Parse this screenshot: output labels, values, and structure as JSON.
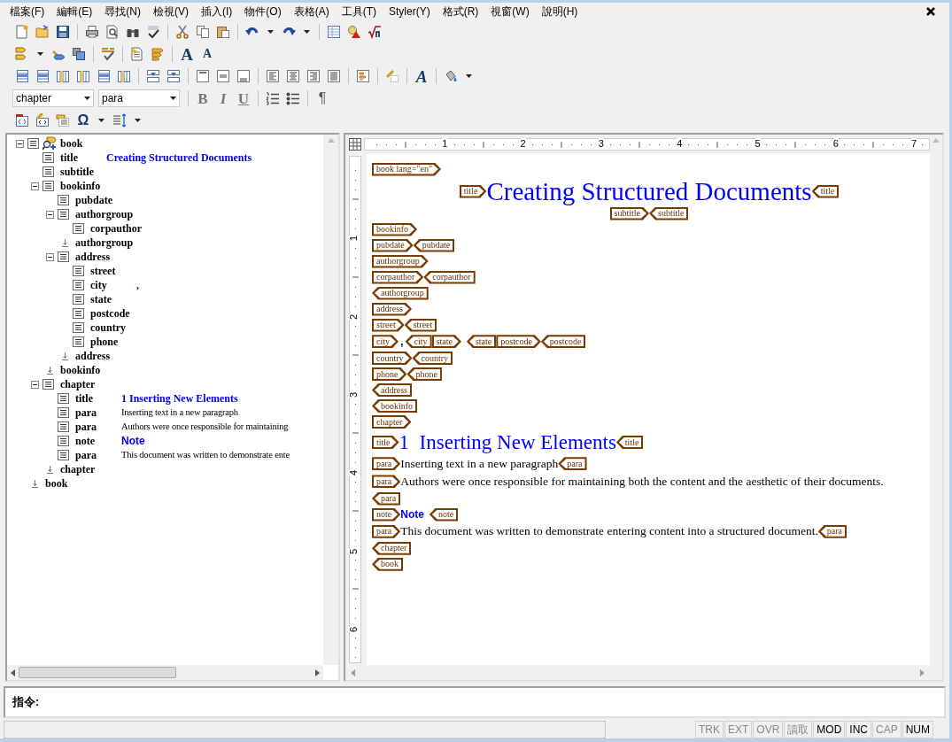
{
  "menu": [
    "檔案(F)",
    "編輯(E)",
    "尋找(N)",
    "檢視(V)",
    "插入(I)",
    "物件(O)",
    "表格(A)",
    "工具(T)",
    "Styler(Y)",
    "格式(R)",
    "視窗(W)",
    "說明(H)"
  ],
  "toolbar": {
    "glyphs": [
      "A",
      "A",
      "A",
      "B",
      "I",
      "U",
      "¶",
      "Ω"
    ],
    "element_combo": "chapter",
    "style_combo": "para"
  },
  "tree": [
    {
      "kind": "root",
      "tag": "book",
      "expanded": true,
      "children": [
        {
          "kind": "element",
          "tag": "title",
          "content": {
            "kind": "heading",
            "text": "Creating Structured Documents"
          }
        },
        {
          "kind": "element",
          "tag": "subtitle"
        },
        {
          "kind": "element",
          "tag": "bookinfo",
          "expanded": true,
          "children": [
            {
              "kind": "element",
              "tag": "pubdate"
            },
            {
              "kind": "element",
              "tag": "authorgroup",
              "expanded": true,
              "children": [
                {
                  "kind": "element",
                  "tag": "corpauthor"
                }
              ]
            },
            {
              "kind": "end",
              "tag": "authorgroup"
            },
            {
              "kind": "element",
              "tag": "address",
              "expanded": true,
              "children": [
                {
                  "kind": "element",
                  "tag": "street"
                },
                {
                  "kind": "element",
                  "tag": "city",
                  "content": {
                    "kind": "emph",
                    "text": ","
                  }
                },
                {
                  "kind": "element",
                  "tag": "state"
                },
                {
                  "kind": "element",
                  "tag": "postcode"
                },
                {
                  "kind": "element",
                  "tag": "country"
                },
                {
                  "kind": "element",
                  "tag": "phone"
                }
              ]
            },
            {
              "kind": "end",
              "tag": "address"
            }
          ]
        },
        {
          "kind": "end",
          "tag": "bookinfo"
        },
        {
          "kind": "element",
          "tag": "chapter",
          "expanded": true,
          "children": [
            {
              "kind": "element",
              "tag": "title",
              "content": {
                "kind": "heading",
                "text": "1  Inserting New Elements"
              }
            },
            {
              "kind": "element",
              "tag": "para",
              "content": {
                "kind": "text",
                "text": "Inserting text in a new paragraph"
              }
            },
            {
              "kind": "element",
              "tag": "para",
              "content": {
                "kind": "text",
                "text": "Authors were once responsible for maintaining"
              }
            },
            {
              "kind": "element",
              "tag": "note",
              "content": {
                "kind": "note",
                "text": "Note"
              }
            },
            {
              "kind": "element",
              "tag": "para",
              "content": {
                "kind": "text",
                "text": "This document was written to demonstrate ente"
              }
            }
          ]
        },
        {
          "kind": "end",
          "tag": "chapter"
        }
      ]
    },
    {
      "kind": "end",
      "tag": "book"
    }
  ],
  "ruler": {
    "horizontal": [
      "1",
      "2",
      "3",
      "4",
      "5",
      "6",
      "7"
    ],
    "vertical": [
      "1",
      "2",
      "3",
      "4",
      "5",
      "6"
    ]
  },
  "document": [
    {
      "centered": false,
      "items": [
        {
          "kind": "open",
          "text": "book lang=\"en\""
        }
      ]
    },
    {
      "centered": true,
      "items": [
        {
          "kind": "open",
          "text": "title"
        },
        {
          "kind": "book-title",
          "text": "Creating Structured Documents"
        },
        {
          "kind": "close",
          "text": "title"
        }
      ]
    },
    {
      "centered": true,
      "items": [
        {
          "kind": "open",
          "text": "subtitle"
        },
        {
          "kind": "close",
          "text": "subtitle"
        }
      ]
    },
    {
      "centered": false,
      "items": [
        {
          "kind": "open",
          "text": "bookinfo"
        }
      ]
    },
    {
      "centered": false,
      "items": [
        {
          "kind": "open",
          "text": "pubdate"
        },
        {
          "kind": "close",
          "text": "pubdate"
        }
      ]
    },
    {
      "centered": false,
      "items": [
        {
          "kind": "open",
          "text": "authorgroup"
        }
      ]
    },
    {
      "centered": false,
      "items": [
        {
          "kind": "open",
          "text": "corpauthor"
        },
        {
          "kind": "close",
          "text": "corpauthor"
        }
      ]
    },
    {
      "centered": false,
      "items": [
        {
          "kind": "close",
          "text": "authorgroup"
        }
      ]
    },
    {
      "centered": false,
      "items": [
        {
          "kind": "open",
          "text": "address"
        }
      ]
    },
    {
      "centered": false,
      "items": [
        {
          "kind": "open",
          "text": "street"
        },
        {
          "kind": "close",
          "text": "street"
        }
      ]
    },
    {
      "centered": false,
      "items": [
        {
          "kind": "open",
          "text": "city"
        },
        {
          "kind": "emph",
          "text": ","
        },
        {
          "kind": "close",
          "text": "city"
        },
        {
          "kind": "open",
          "text": "state"
        },
        {
          "kind": "gap"
        },
        {
          "kind": "close",
          "text": "state"
        },
        {
          "kind": "open",
          "text": "postcode"
        },
        {
          "kind": "close",
          "text": "postcode"
        }
      ]
    },
    {
      "centered": false,
      "items": [
        {
          "kind": "open",
          "text": "country"
        },
        {
          "kind": "close",
          "text": "country"
        }
      ]
    },
    {
      "centered": false,
      "items": [
        {
          "kind": "open",
          "text": "phone"
        },
        {
          "kind": "close",
          "text": "phone"
        }
      ]
    },
    {
      "centered": false,
      "items": [
        {
          "kind": "close",
          "text": "address"
        }
      ]
    },
    {
      "centered": false,
      "items": [
        {
          "kind": "close",
          "text": "bookinfo"
        }
      ]
    },
    {
      "centered": false,
      "items": [
        {
          "kind": "open",
          "text": "chapter"
        }
      ]
    },
    {
      "centered": false,
      "items": [
        {
          "kind": "open",
          "text": "title"
        },
        {
          "kind": "chapter-title",
          "text": "1  Inserting New Elements"
        },
        {
          "kind": "close",
          "text": "title"
        }
      ]
    },
    {
      "centered": false,
      "items": [
        {
          "kind": "open",
          "text": "para"
        },
        {
          "kind": "text",
          "text": "Inserting text in a new paragraph"
        },
        {
          "kind": "close",
          "text": "para"
        }
      ]
    },
    {
      "centered": false,
      "items": [
        {
          "kind": "open",
          "text": "para"
        },
        {
          "kind": "text",
          "text": "Authors were once responsible for maintaining both the content and the aesthetic of their documents."
        }
      ]
    },
    {
      "centered": false,
      "items": [
        {
          "kind": "close",
          "text": "para"
        }
      ]
    },
    {
      "centered": false,
      "items": [
        {
          "kind": "open",
          "text": "note"
        },
        {
          "kind": "note",
          "text": "Note"
        },
        {
          "kind": "gap"
        },
        {
          "kind": "close",
          "text": "note"
        }
      ]
    },
    {
      "centered": false,
      "items": [
        {
          "kind": "open",
          "text": "para"
        },
        {
          "kind": "text",
          "text": "This document was written to demonstrate entering content into a structured document."
        },
        {
          "kind": "close",
          "text": "para"
        }
      ]
    },
    {
      "centered": false,
      "items": [
        {
          "kind": "close",
          "text": "chapter"
        }
      ]
    },
    {
      "centered": false,
      "items": [
        {
          "kind": "close",
          "text": "book"
        }
      ]
    }
  ],
  "command": {
    "label": "指令:"
  },
  "status_bar": [
    {
      "label": "TRK",
      "on": false
    },
    {
      "label": "EXT",
      "on": false
    },
    {
      "label": "OVR",
      "on": false
    },
    {
      "label": "讀取",
      "on": false
    },
    {
      "label": "MOD",
      "on": true
    },
    {
      "label": "INC",
      "on": true
    },
    {
      "label": "CAP",
      "on": false
    },
    {
      "label": "NUM",
      "on": true
    }
  ]
}
